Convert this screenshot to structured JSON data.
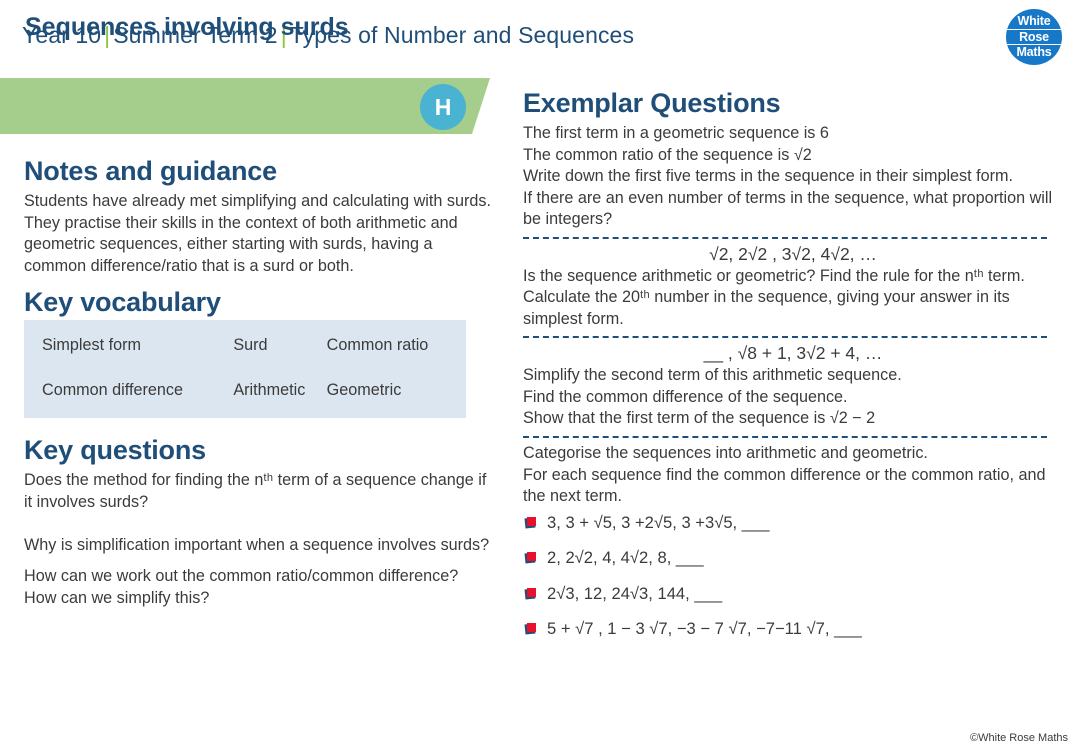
{
  "header": {
    "year": "Year 10",
    "term": "Summer Term 2",
    "unit": "Types of Number and Sequences",
    "logo": {
      "line1": "White",
      "line2": "Rose",
      "line3": "Maths"
    }
  },
  "banner": {
    "lesson_title": "Sequences involving surds",
    "tier_badge": "H"
  },
  "notes": {
    "heading": "Notes and guidance",
    "text": "Students have already met simplifying and calculating with surds. They practise their skills in the context of both arithmetic and geometric sequences, either starting with surds, having a common difference/ratio that is a surd or both."
  },
  "vocabulary": {
    "heading": "Key vocabulary",
    "rows": [
      [
        "Simplest form",
        "Surd",
        "Common ratio"
      ],
      [
        "Common difference",
        "Arithmetic",
        "Geometric"
      ]
    ]
  },
  "key_questions": {
    "heading": "Key questions",
    "items": [
      "Does the method for finding the nᵗʰ term of a sequence change if it involves surds?",
      "Why is simplification important when a sequence involves surds?",
      "How can we work out the common ratio/common difference? How can we simplify this?"
    ]
  },
  "exemplar": {
    "heading": "Exemplar Questions",
    "q1": {
      "lines": [
        "The first term in a geometric sequence is 6",
        "The common ratio of the sequence is √2",
        "Write down the first five terms in the sequence in their simplest form.",
        "If there are an even number of terms in the sequence, what proportion will be integers?"
      ]
    },
    "q2": {
      "sequence": "√2, 2√2 , 3√2,  4√2, …",
      "lines": [
        "Is the sequence arithmetic or geometric? Find the rule for the nᵗʰ term.",
        "Calculate the 20ᵗʰ number in the sequence, giving your answer in its simplest form."
      ]
    },
    "q3": {
      "sequence": "__ , √8 + 1,  3√2 + 4, …",
      "lines": [
        "Simplify the second term of this arithmetic sequence.",
        "Find the common difference of the sequence.",
        "Show that the first term of the sequence is √2 − 2"
      ]
    },
    "q4": {
      "lines": [
        "Categorise the sequences into arithmetic and geometric.",
        "For each sequence find the common difference or the common ratio, and the next term."
      ],
      "sequences": [
        "3, 3 + √5, 3 +2√5, 3 +3√5, ___",
        "2, 2√2, 4, 4√2, 8, ___",
        "2√3, 12, 24√3, 144, ___",
        "5 + √7 , 1 − 3 √7, −3 − 7 √7, −7−11 √7, ___"
      ]
    }
  },
  "footer": {
    "copyright": "©White Rose Maths"
  },
  "colors": {
    "brand_blue": "#1f4e79",
    "banner_green": "#a5ce8c",
    "accent_green": "#8cc63e",
    "badge_cyan": "#4ab3d1",
    "table_blue": "#dce6f1",
    "bullet_red": "#e8112d",
    "logo_blue": "#1878c8"
  }
}
